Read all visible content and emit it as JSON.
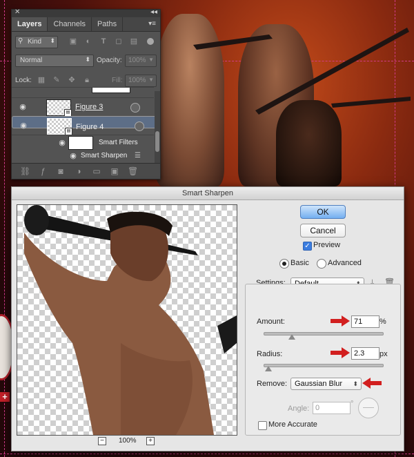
{
  "layers_panel": {
    "close_glyph": "✕",
    "collapse_glyph": "◂◂",
    "tabs": [
      {
        "label": "Layers",
        "active": true
      },
      {
        "label": "Channels",
        "active": false
      },
      {
        "label": "Paths",
        "active": false
      }
    ],
    "menu_glyph": "▾≡",
    "filter_kind": "Kind",
    "blend_mode": "Normal",
    "opacity_label": "Opacity:",
    "opacity_value": "100%",
    "lock_label": "Lock:",
    "fill_label": "Fill:",
    "fill_value": "100%",
    "layers": [
      {
        "name": "Figure 3",
        "underlined": true,
        "selected": false
      },
      {
        "name": "Figure 4",
        "underlined": false,
        "selected": true
      }
    ],
    "smart_filters_label": "Smart Filters",
    "smart_sharpen_label": "Smart Sharpen"
  },
  "dialog": {
    "title": "Smart Sharpen",
    "ok_label": "OK",
    "cancel_label": "Cancel",
    "preview_label": "Preview",
    "preview_checked": true,
    "mode_basic": "Basic",
    "mode_advanced": "Advanced",
    "selected_mode": "Basic",
    "settings_label": "Settings:",
    "settings_value": "Default",
    "amount_label": "Amount:",
    "amount_value": "71",
    "amount_unit": "%",
    "amount_fraction": 0.236,
    "radius_label": "Radius:",
    "radius_value": "2.3",
    "radius_unit": "px",
    "radius_fraction": 0.038,
    "remove_label": "Remove:",
    "remove_value": "Gaussian Blur",
    "angle_label": "Angle:",
    "angle_value": "0",
    "angle_unit": "°",
    "more_accurate_label": "More Accurate",
    "zoom_value": "100%",
    "zoom_out": "−",
    "zoom_in": "+"
  },
  "colors": {
    "annotation_arrow": "#d21f1f",
    "selected_layer": "#5d6e87",
    "ok_button": "#73aef0"
  }
}
